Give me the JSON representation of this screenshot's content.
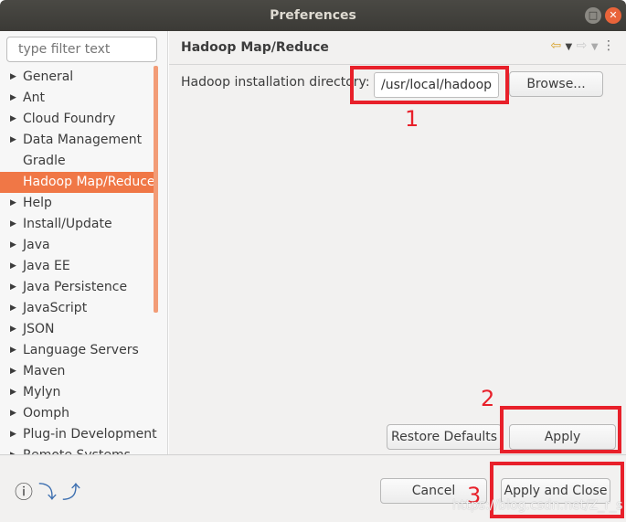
{
  "window": {
    "title": "Preferences"
  },
  "filter": {
    "placeholder": "type filter text"
  },
  "tree": [
    {
      "label": "General",
      "expandable": true
    },
    {
      "label": "Ant",
      "expandable": true
    },
    {
      "label": "Cloud Foundry",
      "expandable": true
    },
    {
      "label": "Data Management",
      "expandable": true
    },
    {
      "label": "Gradle",
      "expandable": false
    },
    {
      "label": "Hadoop Map/Reduce",
      "expandable": false,
      "selected": true
    },
    {
      "label": "Help",
      "expandable": true
    },
    {
      "label": "Install/Update",
      "expandable": true
    },
    {
      "label": "Java",
      "expandable": true
    },
    {
      "label": "Java EE",
      "expandable": true
    },
    {
      "label": "Java Persistence",
      "expandable": true
    },
    {
      "label": "JavaScript",
      "expandable": true
    },
    {
      "label": "JSON",
      "expandable": true
    },
    {
      "label": "Language Servers",
      "expandable": true
    },
    {
      "label": "Maven",
      "expandable": true
    },
    {
      "label": "Mylyn",
      "expandable": true
    },
    {
      "label": "Oomph",
      "expandable": true
    },
    {
      "label": "Plug-in Development",
      "expandable": true
    },
    {
      "label": "Remote Systems",
      "expandable": true
    }
  ],
  "page": {
    "title": "Hadoop Map/Reduce",
    "dir_label": "Hadoop installation directory:",
    "dir_value": "/usr/local/hadoop",
    "browse": "Browse...",
    "restore": "Restore Defaults",
    "apply": "Apply"
  },
  "footer": {
    "cancel": "Cancel",
    "apply_close": "Apply and Close"
  },
  "annotations": {
    "n1": "1",
    "n2": "2",
    "n3": "3"
  },
  "watermark": "https://blog.csdn.net/Z_r_s",
  "colors": {
    "selection": "#f07746",
    "annotation": "#e8202a"
  }
}
